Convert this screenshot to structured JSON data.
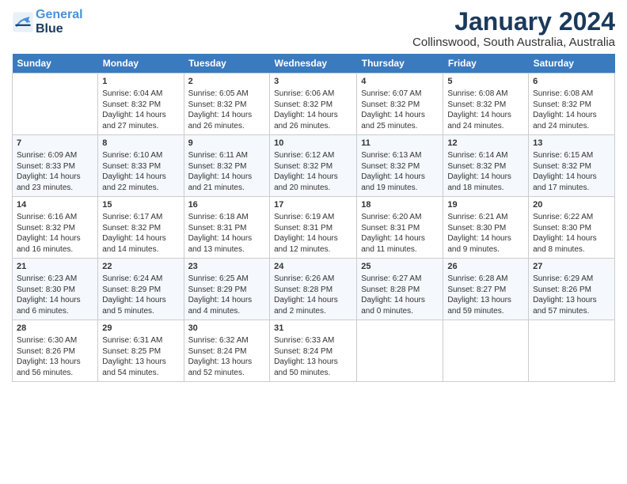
{
  "header": {
    "logo_line1": "General",
    "logo_line2": "Blue",
    "month": "January 2024",
    "location": "Collinswood, South Australia, Australia"
  },
  "days_of_week": [
    "Sunday",
    "Monday",
    "Tuesday",
    "Wednesday",
    "Thursday",
    "Friday",
    "Saturday"
  ],
  "weeks": [
    [
      {
        "day": "",
        "content": ""
      },
      {
        "day": "1",
        "content": "Sunrise: 6:04 AM\nSunset: 8:32 PM\nDaylight: 14 hours\nand 27 minutes."
      },
      {
        "day": "2",
        "content": "Sunrise: 6:05 AM\nSunset: 8:32 PM\nDaylight: 14 hours\nand 26 minutes."
      },
      {
        "day": "3",
        "content": "Sunrise: 6:06 AM\nSunset: 8:32 PM\nDaylight: 14 hours\nand 26 minutes."
      },
      {
        "day": "4",
        "content": "Sunrise: 6:07 AM\nSunset: 8:32 PM\nDaylight: 14 hours\nand 25 minutes."
      },
      {
        "day": "5",
        "content": "Sunrise: 6:08 AM\nSunset: 8:32 PM\nDaylight: 14 hours\nand 24 minutes."
      },
      {
        "day": "6",
        "content": "Sunrise: 6:08 AM\nSunset: 8:32 PM\nDaylight: 14 hours\nand 24 minutes."
      }
    ],
    [
      {
        "day": "7",
        "content": "Sunrise: 6:09 AM\nSunset: 8:33 PM\nDaylight: 14 hours\nand 23 minutes."
      },
      {
        "day": "8",
        "content": "Sunrise: 6:10 AM\nSunset: 8:33 PM\nDaylight: 14 hours\nand 22 minutes."
      },
      {
        "day": "9",
        "content": "Sunrise: 6:11 AM\nSunset: 8:32 PM\nDaylight: 14 hours\nand 21 minutes."
      },
      {
        "day": "10",
        "content": "Sunrise: 6:12 AM\nSunset: 8:32 PM\nDaylight: 14 hours\nand 20 minutes."
      },
      {
        "day": "11",
        "content": "Sunrise: 6:13 AM\nSunset: 8:32 PM\nDaylight: 14 hours\nand 19 minutes."
      },
      {
        "day": "12",
        "content": "Sunrise: 6:14 AM\nSunset: 8:32 PM\nDaylight: 14 hours\nand 18 minutes."
      },
      {
        "day": "13",
        "content": "Sunrise: 6:15 AM\nSunset: 8:32 PM\nDaylight: 14 hours\nand 17 minutes."
      }
    ],
    [
      {
        "day": "14",
        "content": "Sunrise: 6:16 AM\nSunset: 8:32 PM\nDaylight: 14 hours\nand 16 minutes."
      },
      {
        "day": "15",
        "content": "Sunrise: 6:17 AM\nSunset: 8:32 PM\nDaylight: 14 hours\nand 14 minutes."
      },
      {
        "day": "16",
        "content": "Sunrise: 6:18 AM\nSunset: 8:31 PM\nDaylight: 14 hours\nand 13 minutes."
      },
      {
        "day": "17",
        "content": "Sunrise: 6:19 AM\nSunset: 8:31 PM\nDaylight: 14 hours\nand 12 minutes."
      },
      {
        "day": "18",
        "content": "Sunrise: 6:20 AM\nSunset: 8:31 PM\nDaylight: 14 hours\nand 11 minutes."
      },
      {
        "day": "19",
        "content": "Sunrise: 6:21 AM\nSunset: 8:30 PM\nDaylight: 14 hours\nand 9 minutes."
      },
      {
        "day": "20",
        "content": "Sunrise: 6:22 AM\nSunset: 8:30 PM\nDaylight: 14 hours\nand 8 minutes."
      }
    ],
    [
      {
        "day": "21",
        "content": "Sunrise: 6:23 AM\nSunset: 8:30 PM\nDaylight: 14 hours\nand 6 minutes."
      },
      {
        "day": "22",
        "content": "Sunrise: 6:24 AM\nSunset: 8:29 PM\nDaylight: 14 hours\nand 5 minutes."
      },
      {
        "day": "23",
        "content": "Sunrise: 6:25 AM\nSunset: 8:29 PM\nDaylight: 14 hours\nand 4 minutes."
      },
      {
        "day": "24",
        "content": "Sunrise: 6:26 AM\nSunset: 8:28 PM\nDaylight: 14 hours\nand 2 minutes."
      },
      {
        "day": "25",
        "content": "Sunrise: 6:27 AM\nSunset: 8:28 PM\nDaylight: 14 hours\nand 0 minutes."
      },
      {
        "day": "26",
        "content": "Sunrise: 6:28 AM\nSunset: 8:27 PM\nDaylight: 13 hours\nand 59 minutes."
      },
      {
        "day": "27",
        "content": "Sunrise: 6:29 AM\nSunset: 8:26 PM\nDaylight: 13 hours\nand 57 minutes."
      }
    ],
    [
      {
        "day": "28",
        "content": "Sunrise: 6:30 AM\nSunset: 8:26 PM\nDaylight: 13 hours\nand 56 minutes."
      },
      {
        "day": "29",
        "content": "Sunrise: 6:31 AM\nSunset: 8:25 PM\nDaylight: 13 hours\nand 54 minutes."
      },
      {
        "day": "30",
        "content": "Sunrise: 6:32 AM\nSunset: 8:24 PM\nDaylight: 13 hours\nand 52 minutes."
      },
      {
        "day": "31",
        "content": "Sunrise: 6:33 AM\nSunset: 8:24 PM\nDaylight: 13 hours\nand 50 minutes."
      },
      {
        "day": "",
        "content": ""
      },
      {
        "day": "",
        "content": ""
      },
      {
        "day": "",
        "content": ""
      }
    ]
  ]
}
